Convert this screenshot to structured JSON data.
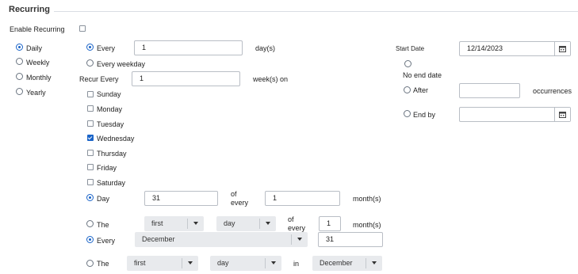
{
  "section": {
    "title": "Recurring"
  },
  "enable_recurring": {
    "label": "Enable Recurring",
    "checked": false
  },
  "frequency": [
    {
      "label": "Daily",
      "selected": true
    },
    {
      "label": "Weekly",
      "selected": false
    },
    {
      "label": "Monthly",
      "selected": false
    },
    {
      "label": "Yearly",
      "selected": false
    }
  ],
  "daily": {
    "every_label": "Every",
    "every_value": "1",
    "days_label": "day(s)",
    "every_weekday_label": "Every weekday"
  },
  "weekly": {
    "recur_every_label": "Recur Every",
    "weeks_value": "1",
    "weeks_on_label": "week(s) on",
    "days": [
      {
        "label": "Sunday",
        "checked": false
      },
      {
        "label": "Monday",
        "checked": false
      },
      {
        "label": "Tuesday",
        "checked": false
      },
      {
        "label": "Wednesday",
        "checked": true
      },
      {
        "label": "Thursday",
        "checked": false
      },
      {
        "label": "Friday",
        "checked": false
      },
      {
        "label": "Saturday",
        "checked": false
      }
    ]
  },
  "monthly": {
    "day_label": "Day",
    "day_value": "31",
    "of_every_label": "of every",
    "months_value": "1",
    "months_label": "month(s)",
    "the_label": "The",
    "ordinal": "first",
    "day_type": "day",
    "of_every_label_2": "of every",
    "months_value_2": "1",
    "months_label_2": "month(s)"
  },
  "yearly": {
    "every_label": "Every",
    "month": "December",
    "day_value": "31",
    "the_label": "The",
    "ordinal": "first",
    "day_type": "day",
    "in_label": "in",
    "month_2": "December"
  },
  "range": {
    "start_date_label": "Start Date",
    "start_date_value": "12/14/2023",
    "no_end_label": "No end date",
    "after_label": "After",
    "after_value": "",
    "occurrences_label": "occurrences",
    "end_by_label": "End by",
    "end_by_value": ""
  },
  "icons": {
    "calendar": "calendar-icon",
    "dropdown": "chevron-down-icon"
  },
  "colors": {
    "accent": "#1a64c8",
    "select_bg": "#e8eaed",
    "border": "#b9bec5"
  }
}
